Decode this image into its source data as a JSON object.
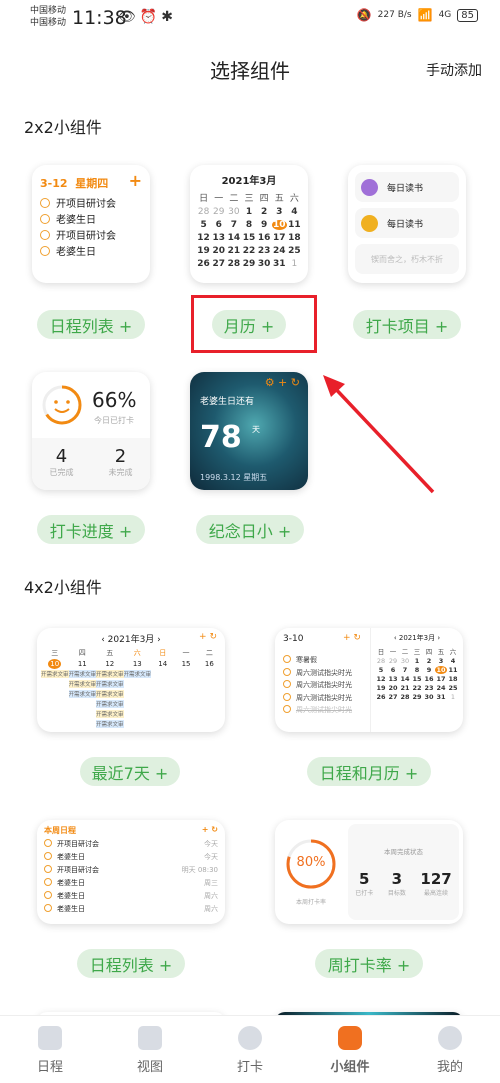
{
  "status": {
    "carrier1": "中国移动",
    "carrier2": "中国移动",
    "time": "11:38",
    "net_speed": "227 B/s",
    "signal": "4G",
    "battery": "85"
  },
  "header": {
    "title": "选择组件",
    "manual_add": "手动添加"
  },
  "sec2x2": "2x2小组件",
  "sec4x2": "4x2小组件",
  "schedule": {
    "date": "3-12",
    "weekday": "星期四",
    "add": "+",
    "items": [
      "开项目研讨会",
      "老婆生日",
      "开项目研讨会",
      "老婆生日"
    ],
    "button": "日程列表 +"
  },
  "month": {
    "title": "2021年3月",
    "weekdays": [
      "日",
      "一",
      "二",
      "三",
      "四",
      "五",
      "六"
    ],
    "days": [
      "28",
      "29",
      "30",
      "1",
      "2",
      "3",
      "4",
      "5",
      "6",
      "7",
      "8",
      "9",
      "10",
      "11",
      "12",
      "13",
      "14",
      "15",
      "16",
      "17",
      "18",
      "19",
      "20",
      "21",
      "22",
      "23",
      "24",
      "25",
      "26",
      "27",
      "28",
      "29",
      "30",
      "31",
      "1"
    ],
    "today": "10",
    "button": "月历 +"
  },
  "checkin": {
    "items": [
      "每日读书",
      "每日读书"
    ],
    "quote": "锲而舍之，朽木不折",
    "button": "打卡项目 +"
  },
  "progress": {
    "percent": "66%",
    "label": "今日已打卡",
    "done": "4",
    "done_label": "已完成",
    "undone": "2",
    "undone_label": "未完成",
    "fill": 0.66,
    "button": "打卡进度 +"
  },
  "anniv": {
    "title": "老婆生日还有",
    "days": "78",
    "unit": "天",
    "date": "1998.3.12",
    "weekday": "星期五",
    "button": "纪念日小 +"
  },
  "week7": {
    "title": "2021年3月",
    "weekdays": [
      "三",
      "四",
      "五",
      "六",
      "日",
      "一",
      "二"
    ],
    "dates": [
      "10",
      "11",
      "12",
      "13",
      "14",
      "15",
      "16"
    ],
    "event": "开需求文审",
    "button": "最近7天 +"
  },
  "schedcal": {
    "date": "3-10",
    "title": "2021年3月",
    "items": [
      "寒暑假",
      "周六测试指尖时光",
      "周六测试指尖时光",
      "周六测试指尖时光",
      "周六测试指尖时光"
    ],
    "button": "日程和月历 +"
  },
  "weeksched": {
    "title": "本周日程",
    "items": [
      {
        "t": "开项目研讨会",
        "d": "今天"
      },
      {
        "t": "老婆生日",
        "d": "今天"
      },
      {
        "t": "开项目研讨会",
        "d": "明天 08:30"
      },
      {
        "t": "老婆生日",
        "d": "周三"
      },
      {
        "t": "老婆生日",
        "d": "周六"
      },
      {
        "t": "老婆生日",
        "d": "周六"
      }
    ],
    "button": "日程列表 +"
  },
  "weekrate": {
    "percent": "80%",
    "label": "本周打卡率",
    "status": "本周完成状态",
    "stats": [
      {
        "v": "5",
        "l": "已打卡"
      },
      {
        "v": "3",
        "l": "目标数"
      },
      {
        "v": "127",
        "l": "最高连续"
      }
    ],
    "fill": 0.8,
    "button": "周打卡率 +"
  },
  "nav": [
    {
      "label": "日程"
    },
    {
      "label": "视图"
    },
    {
      "label": "打卡"
    },
    {
      "label": "小组件",
      "active": true
    },
    {
      "label": "我的"
    }
  ],
  "colors": {
    "accent": "#f28a12",
    "green": "#3fa84a",
    "pill": "#dff0df",
    "highlight": "#e8202a"
  }
}
